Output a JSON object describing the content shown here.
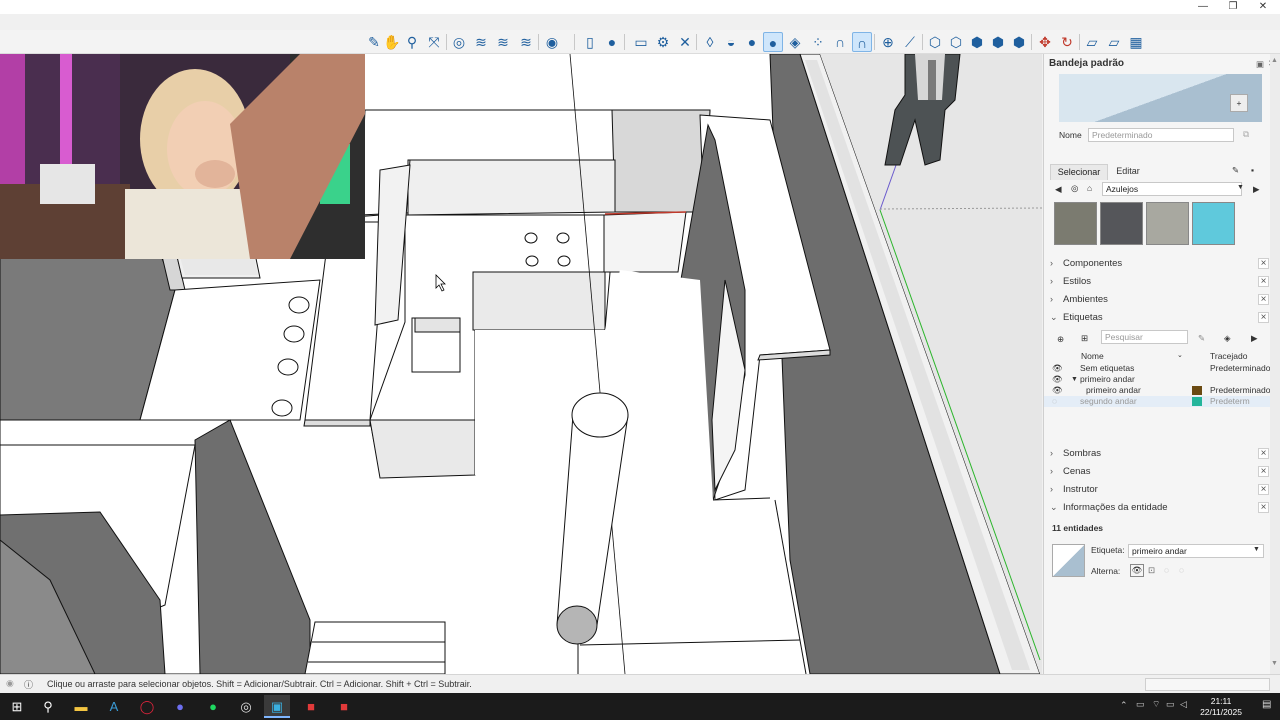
{
  "window": {
    "minimize": "—",
    "maximize": "❐",
    "close": "✕"
  },
  "toolbar": {
    "icons": [
      "paint-bucket-icon",
      "hand-icon",
      "zoom-icon",
      "zoom-extents-icon",
      "section-icon",
      "section-display-icon",
      "section-fill-icon",
      "section-cut-icon",
      "previous-view-icon",
      "standard-view-icon",
      "page-icon",
      "person-icon",
      "rectangle-icon",
      "settings-icon",
      "close-icon",
      "sandbox-1-icon",
      "sandbox-2-icon",
      "sandbox-3-icon",
      "sandbox-active-icon",
      "sandbox-5-icon",
      "dots-icon",
      "magnet-1-icon",
      "magnet-2-icon",
      "add-icon",
      "connect-icon",
      "cube-1-icon",
      "cube-2-icon",
      "cube-3-icon",
      "cube-4-icon",
      "cube-5-icon",
      "move-icon",
      "rotate-icon",
      "layer-1-icon",
      "layer-2-icon",
      "layer-3-icon"
    ]
  },
  "tray": {
    "title": "Bandeja padrão",
    "materials": {
      "name_label": "Nome",
      "name_value": "Predeterminado",
      "tab_select": "Selecionar",
      "tab_edit": "Editar",
      "category": "Azulejos",
      "swatch_colors": [
        "#7b7b70",
        "#55565a",
        "#a8a8a0",
        "#5fc9dc"
      ]
    },
    "panels_top": [
      "Componentes",
      "Estilos",
      "Ambientes"
    ],
    "tags": {
      "title": "Etiquetas",
      "search_placeholder": "Pesquisar",
      "col_name": "Nome",
      "col_dash": "Tracejado",
      "rows": [
        {
          "name": "Sem etiquetas",
          "dash": "Predeterminado",
          "color": ""
        },
        {
          "name": "primeiro andar",
          "dash": "",
          "color": "",
          "folder": true
        },
        {
          "name": "primeiro andar",
          "dash": "Predeterminado",
          "color": "#6b4a12"
        },
        {
          "name": "segundo andar",
          "dash": "Predeterm",
          "color": "#24b59b",
          "muted": true
        }
      ]
    },
    "panels_bottom": [
      "Sombras",
      "Cenas",
      "Instrutor"
    ],
    "entity": {
      "title": "Informações da entidade",
      "count": "11 entidades",
      "tag_label": "Etiqueta:",
      "tag_value": "primeiro andar",
      "toggle_label": "Alterna:"
    }
  },
  "status": {
    "message": "Clique ou arraste para selecionar objetos. Shift = Adicionar/Subtrair. Ctrl = Adicionar. Shift + Ctrl = Subtrair."
  },
  "taskbar": {
    "time": "21:11",
    "date": "22/11/2025",
    "apps": [
      "windows-start-icon",
      "search-icon",
      "file-explorer-icon",
      "autocad-icon",
      "opera-icon",
      "discord-icon",
      "spotify-icon",
      "chrome-icon",
      "sketchup-icon",
      "app-red-1-icon",
      "app-red-2-icon"
    ]
  }
}
